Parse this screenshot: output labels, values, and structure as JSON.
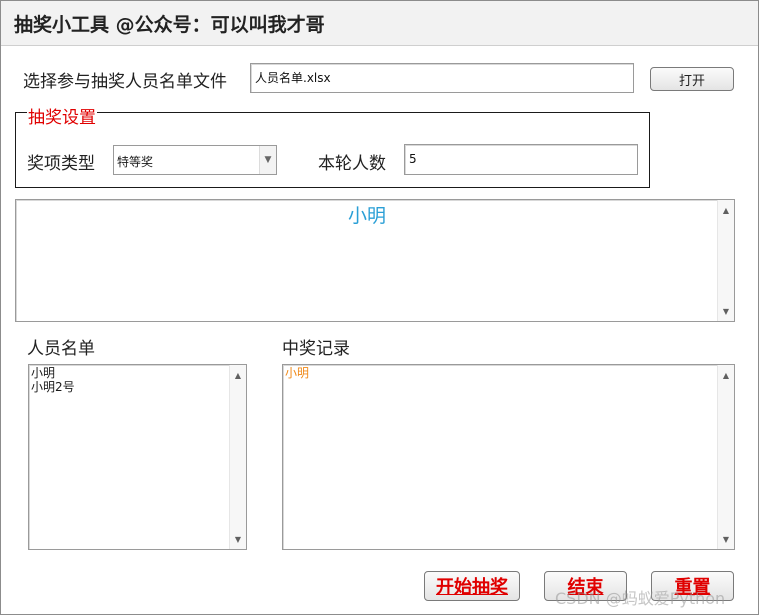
{
  "window": {
    "title": "抽奖小工具 @公众号：可以叫我才哥"
  },
  "file": {
    "label": "选择参与抽奖人员名单文件",
    "value": "人员名单.xlsx",
    "open_button": "打开"
  },
  "settings": {
    "group_label": "抽奖设置",
    "prize_type_label": "奖项类型",
    "prize_type_value": "特等奖",
    "count_label": "本轮人数",
    "count_value": "5"
  },
  "display": {
    "current_name": "小明"
  },
  "roster": {
    "label": "人员名单",
    "items": [
      "小明",
      "小明2号"
    ]
  },
  "records": {
    "label": "中奖记录",
    "items": [
      "小明"
    ]
  },
  "actions": {
    "start": "开始抽奖",
    "stop": "结束",
    "reset": "重置"
  },
  "watermark": "CSDN @蚂蚁爱Python",
  "colors": {
    "accent_red": "#e00000",
    "display_blue": "#2a9fd6",
    "record_orange": "#f08a1a"
  },
  "icons": {
    "scroll_up": "up-triangle",
    "scroll_down": "down-triangle",
    "combo_dropdown": "down-triangle"
  }
}
